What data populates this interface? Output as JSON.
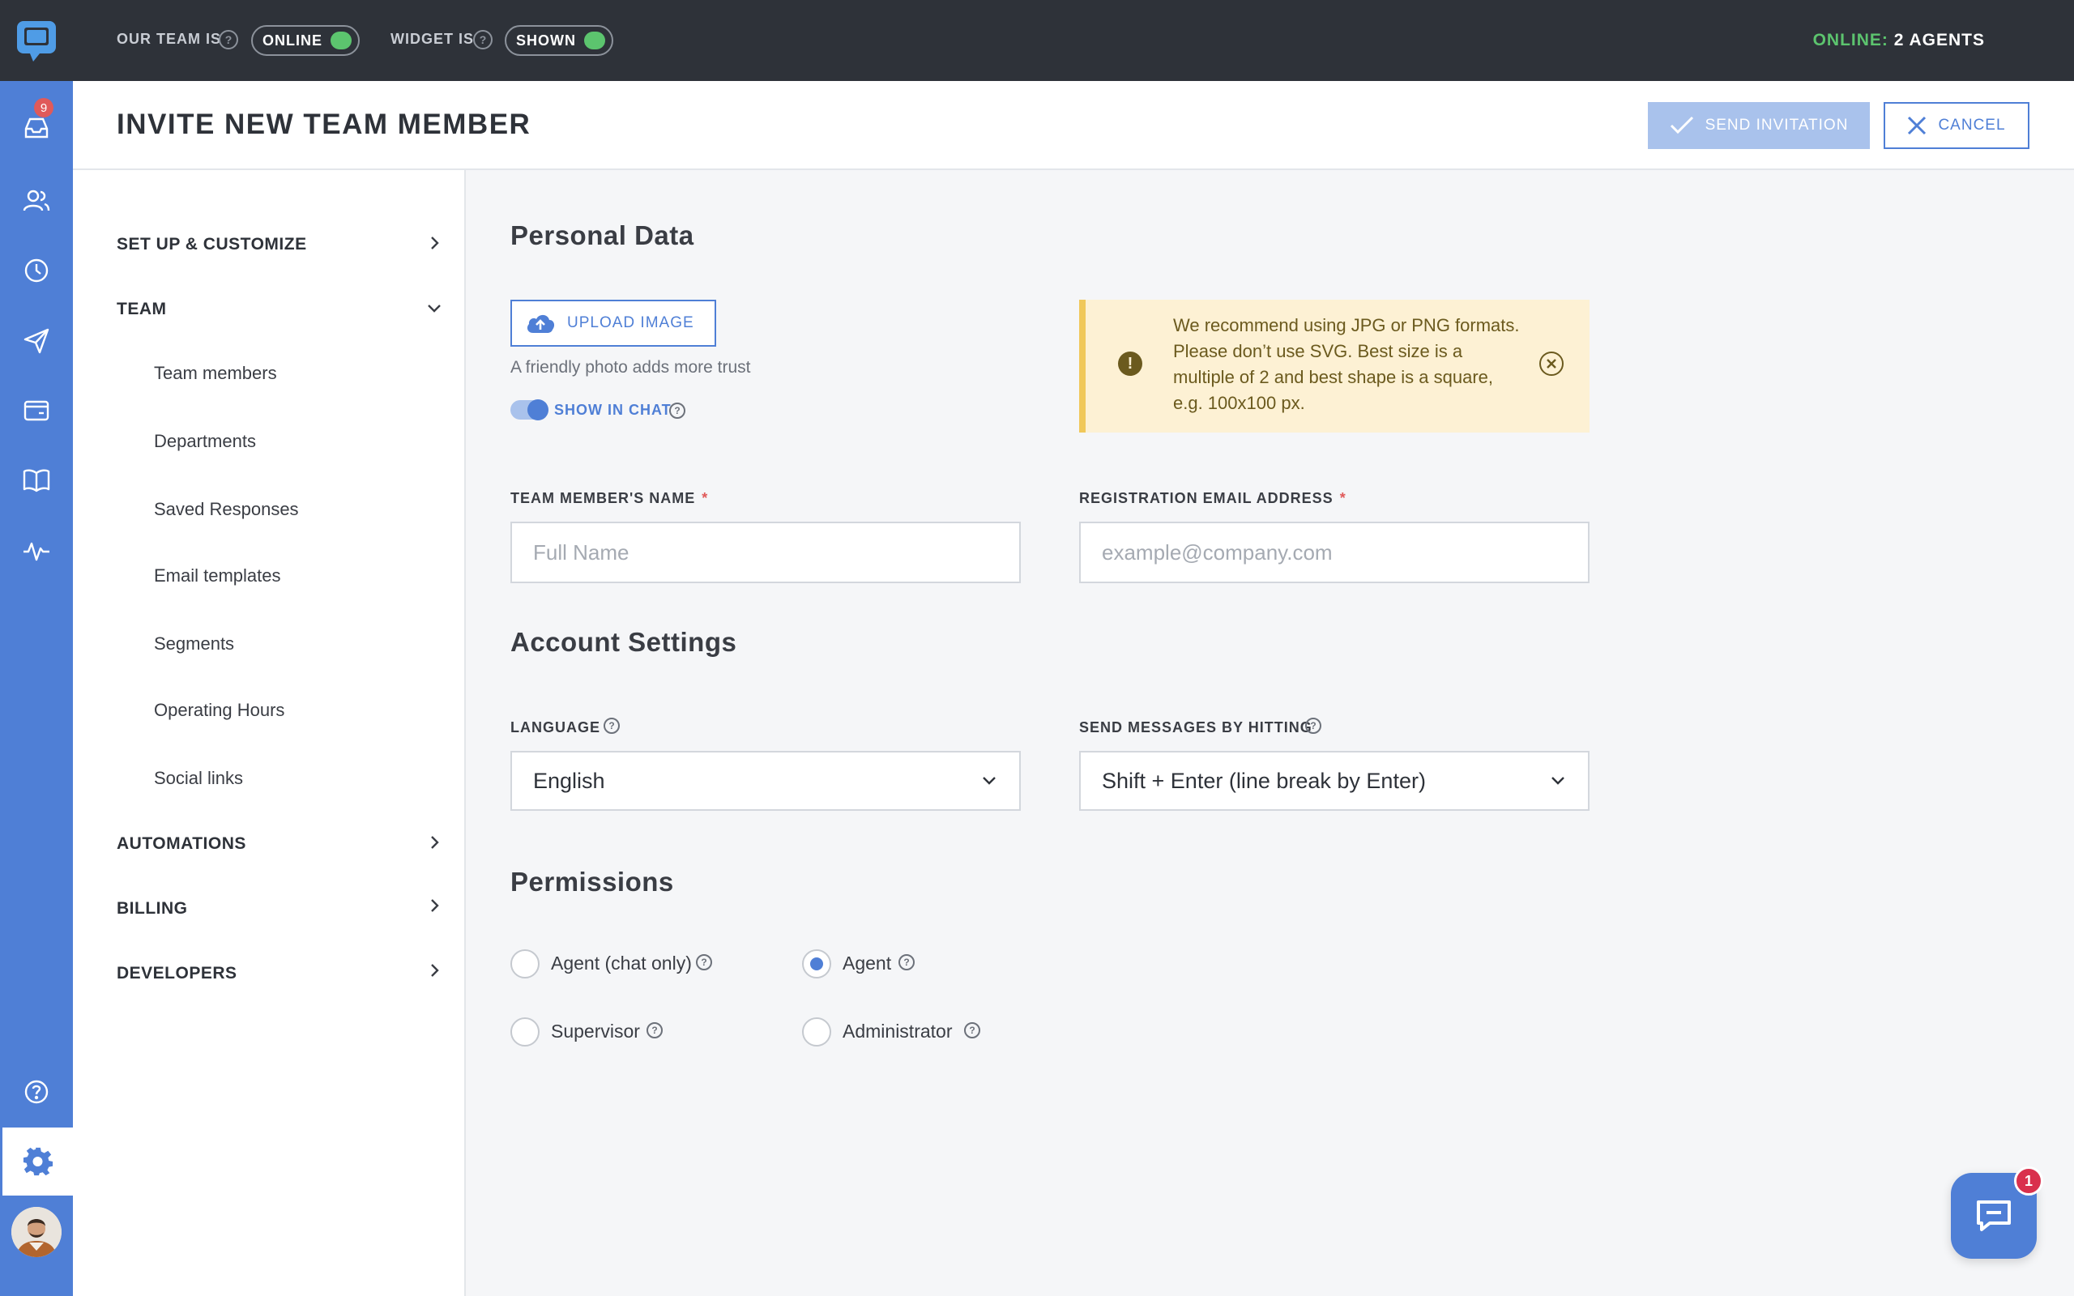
{
  "topbar": {
    "team_label": "OUR TEAM IS",
    "team_status": "ONLINE",
    "widget_label": "WIDGET IS",
    "widget_status": "SHOWN",
    "online_label": "ONLINE:",
    "online_value": "2 AGENTS",
    "status_color": "#5cc46e"
  },
  "rail": {
    "inbox_badge": "9",
    "items": [
      "inbox-icon",
      "contacts-icon",
      "history-icon",
      "campaigns-icon",
      "widget-icon",
      "knowledge-base-icon",
      "analytics-icon"
    ],
    "bottom": [
      "help-icon",
      "settings-icon",
      "avatar"
    ]
  },
  "header": {
    "title": "INVITE NEW TEAM MEMBER",
    "send_label": "SEND INVITATION",
    "cancel_label": "CANCEL"
  },
  "nav": {
    "sections": [
      {
        "label": "SET UP & CUSTOMIZE",
        "expanded": false
      },
      {
        "label": "TEAM",
        "expanded": true
      },
      {
        "label": "AUTOMATIONS",
        "expanded": false
      },
      {
        "label": "BILLING",
        "expanded": false
      },
      {
        "label": "DEVELOPERS",
        "expanded": false
      }
    ],
    "team_items": [
      "Team members",
      "Departments",
      "Saved Responses",
      "Email templates",
      "Segments",
      "Operating Hours",
      "Social links"
    ]
  },
  "personal": {
    "heading": "Personal Data",
    "upload_label": "UPLOAD IMAGE",
    "upload_hint": "A friendly photo adds more trust",
    "show_in_chat_label": "SHOW IN CHAT",
    "show_in_chat": true,
    "notice": "We recommend using JPG or PNG formats. Please don’t use SVG. Best size is a multiple of 2 and best shape is a square, e.g. 100x100 px.",
    "name_label": "TEAM MEMBER'S NAME",
    "name_placeholder": "Full Name",
    "name_value": "",
    "email_label": "REGISTRATION EMAIL ADDRESS",
    "email_placeholder": "example@company.com",
    "email_value": "",
    "required_mark": "*"
  },
  "account": {
    "heading": "Account Settings",
    "language_label": "LANGUAGE",
    "language_value": "English",
    "send_label": "SEND MESSAGES BY HITTING",
    "send_value": "Shift + Enter (line break by Enter)"
  },
  "permissions": {
    "heading": "Permissions",
    "options": [
      {
        "label": "Agent (chat only)",
        "checked": false
      },
      {
        "label": "Agent",
        "checked": true
      },
      {
        "label": "Supervisor",
        "checked": false
      },
      {
        "label": "Administrator",
        "checked": false
      }
    ]
  },
  "chat_widget": {
    "badge": "1"
  },
  "colors": {
    "accent": "#4f7fd6",
    "dark": "#2e3239",
    "notice_bg": "#fdf1d4",
    "badge_red": "#e05a5a"
  }
}
